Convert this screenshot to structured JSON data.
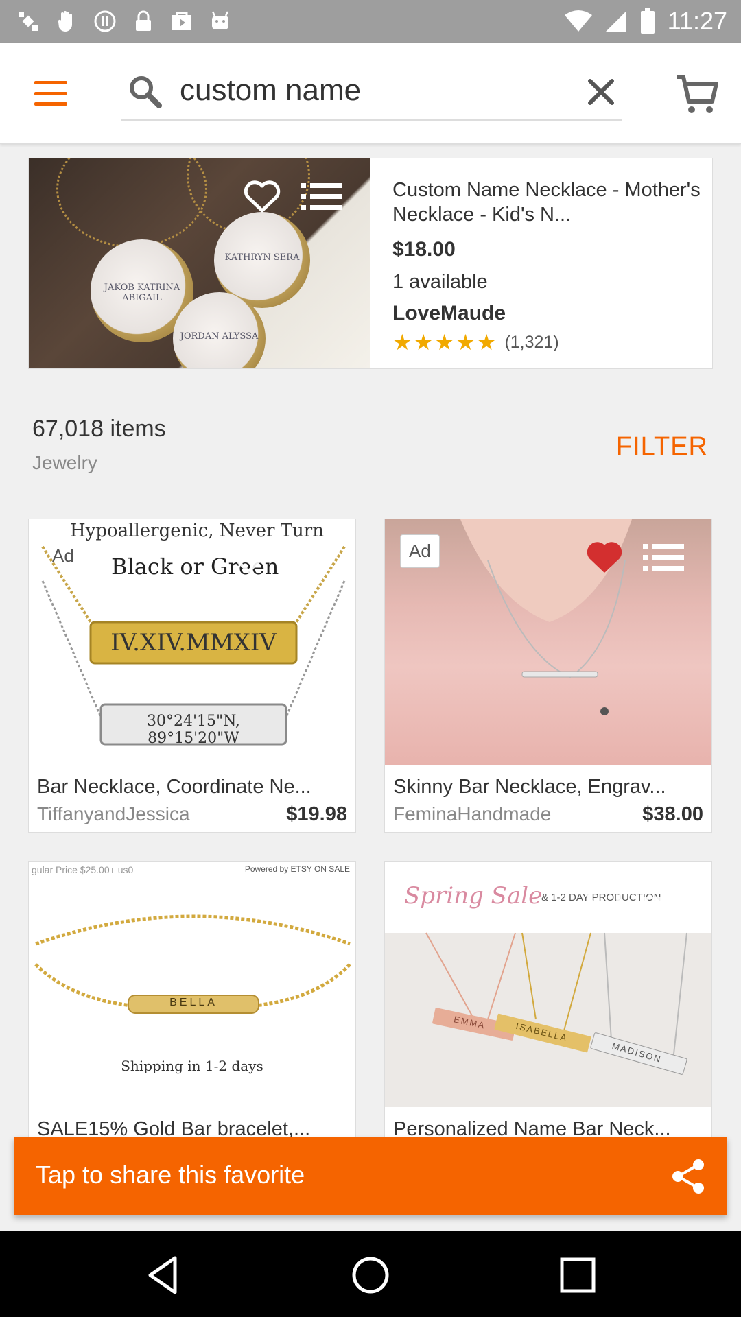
{
  "status_bar": {
    "time": "11:27"
  },
  "search": {
    "query": "custom name"
  },
  "featured": {
    "title": "Custom Name Necklace - Mother's Necklace - Kid's N...",
    "price": "$18.00",
    "availability": "1 available",
    "shop": "LoveMaude",
    "stars": "★★★★★",
    "rating_count": "(1,321)",
    "rating": 5,
    "pendant_names": [
      "JAKOB KATRINA ABIGAIL",
      "KATHRYN SERA",
      "JORDAN ALYSSA"
    ]
  },
  "results": {
    "count": "67,018 items",
    "category": "Jewelry",
    "filter_label": "FILTER"
  },
  "listings": [
    {
      "title": "Bar Necklace, Coordinate Ne...",
      "shop": "TiffanyandJessica",
      "price": "$19.98",
      "ad": "Ad",
      "favorited": false,
      "image_text": [
        "Hypoallergenic, Never Turn",
        "Black or Green",
        "IV.XIV.MMXIV",
        "30°24'15\"N, 89°15'20\"W"
      ]
    },
    {
      "title": "Skinny Bar Necklace, Engrav...",
      "shop": "FeminaHandmade",
      "price": "$38.00",
      "ad": "Ad",
      "favorited": true
    },
    {
      "title": "SALE15% Gold  Bar bracelet,...",
      "favorited": false,
      "image_text": [
        "gular Price $25.00+ us0",
        "Powered by ETSY ON SALE",
        "BELLA",
        "Shipping in 1-2 days"
      ]
    },
    {
      "title": "Personalized Name Bar Neck...",
      "favorited": false,
      "image_text": [
        "Spring Sale",
        "& 1-2 DAY PRODUCTION",
        "EMMA",
        "ISABELLA",
        "MADISON"
      ]
    }
  ],
  "toast": {
    "message": "Tap to share this favorite"
  },
  "colors": {
    "accent": "#f56400",
    "status_bar": "#9e9e9e",
    "star": "#f1a900",
    "heart_active": "#d32f2f"
  },
  "icons": [
    "menu-icon",
    "search-icon",
    "close-icon",
    "cart-icon",
    "heart-icon",
    "list-icon",
    "share-icon",
    "back-icon",
    "home-icon",
    "recents-icon"
  ]
}
